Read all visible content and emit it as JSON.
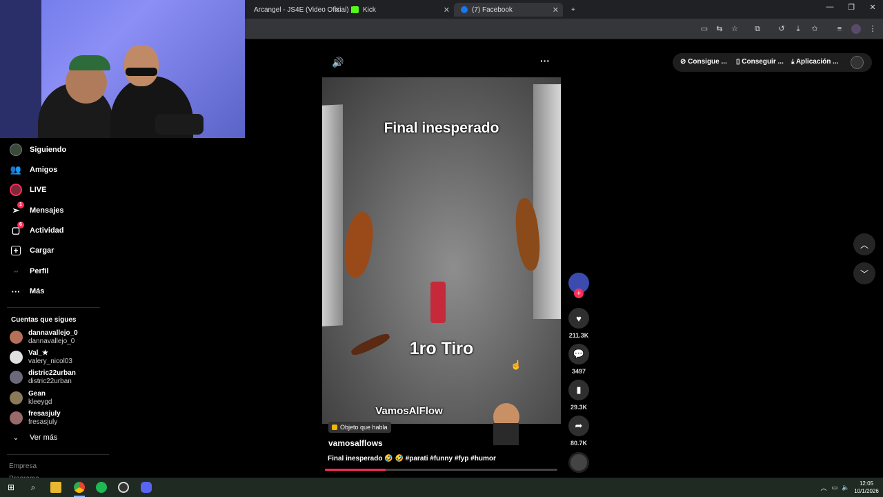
{
  "browser": {
    "tabs": [
      {
        "title": "Arcangel - JS4E (Video Oficial) |",
        "icon": "youtube-icon"
      },
      {
        "title": "Kick",
        "icon": "kick-icon"
      },
      {
        "title": "(7) Facebook",
        "icon": "facebook-icon"
      }
    ],
    "new_tab": "+"
  },
  "sidebar": {
    "items": [
      {
        "label": "Siguiendo",
        "icon": "following-icon"
      },
      {
        "label": "Amigos",
        "icon": "friends-icon"
      },
      {
        "label": "LIVE",
        "icon": "live-icon"
      },
      {
        "label": "Mensajes",
        "icon": "messages-icon",
        "badge": "1"
      },
      {
        "label": "Actividad",
        "icon": "activity-icon",
        "badge": "6"
      },
      {
        "label": "Cargar",
        "icon": "upload-icon"
      },
      {
        "label": "Perfil",
        "icon": "profile-icon"
      },
      {
        "label": "Más",
        "icon": "more-icon"
      }
    ],
    "following_title": "Cuentas que sigues",
    "accounts": [
      {
        "name": "dannavallejo_0",
        "handle": "dannavallejo_0"
      },
      {
        "name": "Val_★",
        "handle": "valery_nicol03"
      },
      {
        "name": "distric22urban",
        "handle": "distric22urban"
      },
      {
        "name": "Gean",
        "handle": "kleeygd"
      },
      {
        "name": "fresasjuly",
        "handle": "fresasjuly"
      }
    ],
    "see_more": "Ver más",
    "footer": [
      "Empresa",
      "Programa"
    ]
  },
  "top_pill": {
    "items": [
      "Consigue ...",
      "Conseguir ...",
      "Aplicación ..."
    ]
  },
  "video": {
    "overlay_top": "Final inesperado",
    "overlay_middle": "1ro Tiro",
    "watermark": "VamosAlFlow",
    "sticker": "Objeto que habla",
    "author": "vamosalflows",
    "caption": "Final inesperado 🤣 🤣 #parati #funny #fyp #humor",
    "progress": 0.26
  },
  "actions": {
    "likes": "211.3K",
    "comments": "3497",
    "saves": "29.3K",
    "shares": "80.7K"
  },
  "taskbar": {
    "time": "12:05",
    "date": "10/1/2026"
  }
}
